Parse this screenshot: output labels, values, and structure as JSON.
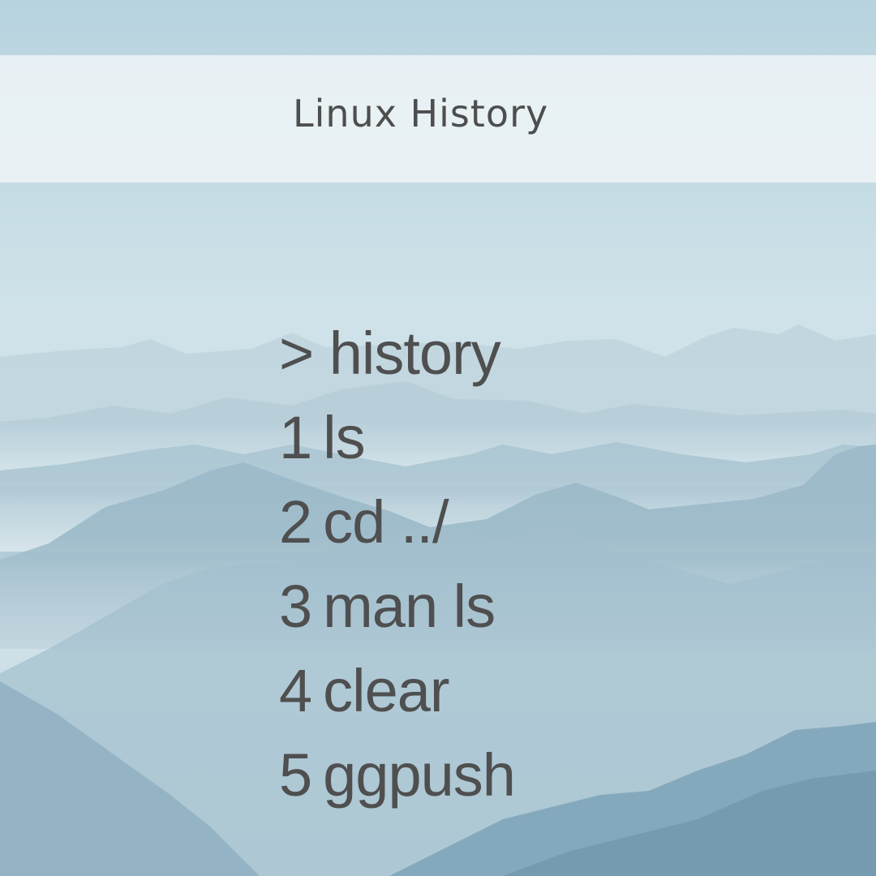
{
  "header": {
    "title": "Linux History"
  },
  "terminal": {
    "prompt": {
      "symbol": ">",
      "command": "history"
    },
    "entries": [
      {
        "num": "1",
        "command": "ls"
      },
      {
        "num": "2",
        "command": "cd ../"
      },
      {
        "num": "3",
        "command": "man ls"
      },
      {
        "num": "4",
        "command": "clear"
      },
      {
        "num": "5",
        "command": "ggpush"
      }
    ]
  },
  "colors": {
    "sky": "#b9d5e0",
    "text": "#4f4f50",
    "band": "#eef4f6"
  },
  "background": {
    "image": "misty-mountain-range"
  }
}
